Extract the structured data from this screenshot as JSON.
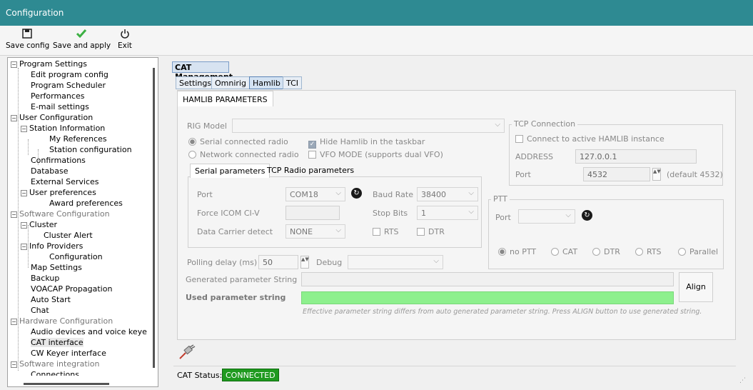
{
  "window": {
    "title": "Configuration"
  },
  "toolbar": {
    "save_config": "Save config",
    "save_and_apply": "Save and apply",
    "exit": "Exit",
    "icons": [
      "save-icon",
      "checkmark-icon",
      "power-icon"
    ]
  },
  "tree": {
    "items": [
      "Program Settings",
      "Edit program config",
      "Program Scheduler",
      "Performances",
      "E-mail settings",
      "User Configuration",
      "Station Information",
      "My References",
      "Station configuration",
      "Confirmations",
      "Database",
      "External Services",
      "User preferences",
      "Award preferences",
      "Software Configuration",
      "Cluster",
      "Cluster Alert",
      "Info Providers",
      "Configuration",
      "Map Settings",
      "Backup",
      "VOACAP Propagation",
      "Auto Start",
      "Chat",
      "Hardware Configuration",
      "Audio devices and voice keye",
      "CAT interface",
      "CW Keyer interface",
      "Software integration",
      "Connections"
    ]
  },
  "cat": {
    "title": "CAT Management",
    "tabs": [
      "Settings",
      "Omnirig",
      "Hamlib",
      "TCI"
    ],
    "active_tab": "Hamlib"
  },
  "hamlib": {
    "section_tab": "HAMLIB PARAMETERS",
    "rig_model_label": "RIG Model",
    "rig_model_value": "",
    "serial_radio": "Serial connected radio",
    "network_radio": "Network connected radio",
    "hide_taskbar": "Hide Hamlib in the taskbar",
    "vfo_mode": "VFO MODE (supports dual VFO)",
    "sub_tabs": [
      "Serial parameters",
      "TCP Radio parameters"
    ],
    "port_label": "Port",
    "port_value": "COM18",
    "baud_label": "Baud Rate",
    "baud_value": "38400",
    "force_icom_label": "Force ICOM CI-V",
    "stop_bits_label": "Stop Bits",
    "stop_bits_value": "1",
    "data_carrier_label": "Data Carrier detect",
    "data_carrier_value": "NONE",
    "rts": "RTS",
    "dtr": "DTR",
    "polling_label": "Polling delay (ms)",
    "polling_value": "50",
    "debug_label": "Debug",
    "generated_label": "Generated parameter String",
    "used_label": "Used parameter string",
    "align_button": "Align",
    "note": "Effective parameter string differs from auto generated parameter string. Press ALIGN button to use generated string.",
    "used_bar_color": "#8df08d"
  },
  "tcp": {
    "title": "TCP Connection",
    "connect_label": "Connect to active HAMLIB instance",
    "address_label": "ADDRESS",
    "address_value": "127.0.0.1",
    "port_label": "Port",
    "port_value": "4532",
    "default_note": "(default 4532)"
  },
  "ptt": {
    "title": "PTT",
    "port_label": "Port",
    "options": [
      "no PTT",
      "CAT",
      "DTR",
      "RTS",
      "Parallel"
    ],
    "selected": "no PTT"
  },
  "status": {
    "label": "CAT Status:",
    "value": "CONNECTED",
    "color": "#1f9a1f"
  }
}
